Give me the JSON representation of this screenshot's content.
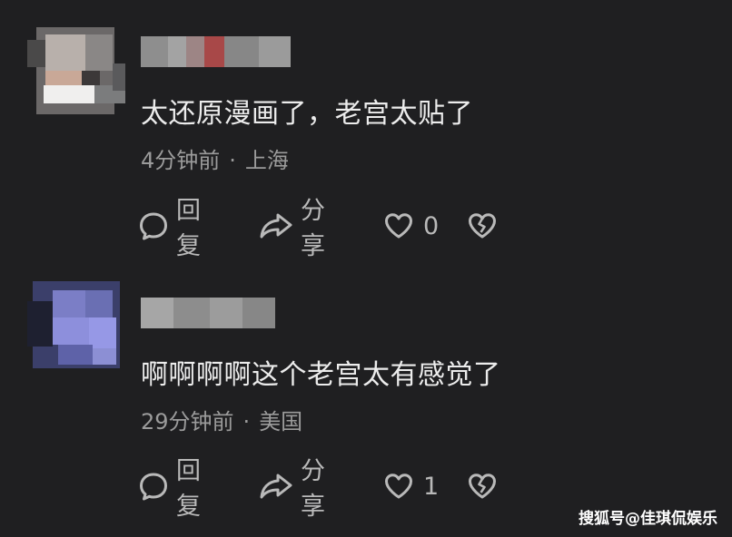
{
  "comments": [
    {
      "text": "太还原漫画了，老宫太贴了",
      "time": "4分钟前",
      "location": "上海",
      "reply_label": "回复",
      "share_label": "分享",
      "likes": "0"
    },
    {
      "text": "啊啊啊啊这个老宫太有感觉了",
      "time": "29分钟前",
      "location": "美国",
      "reply_label": "回复",
      "share_label": "分享",
      "likes": "1"
    }
  ],
  "separator": "·",
  "watermark": "搜狐号@佳琪侃娱乐",
  "icons": [
    "comment-icon",
    "share-icon",
    "heart-icon",
    "broken-heart-icon"
  ],
  "colors": {
    "background": "#1f1f21",
    "text": "#ececec",
    "meta": "#9b9b9b",
    "icon": "#b9b9b9"
  }
}
